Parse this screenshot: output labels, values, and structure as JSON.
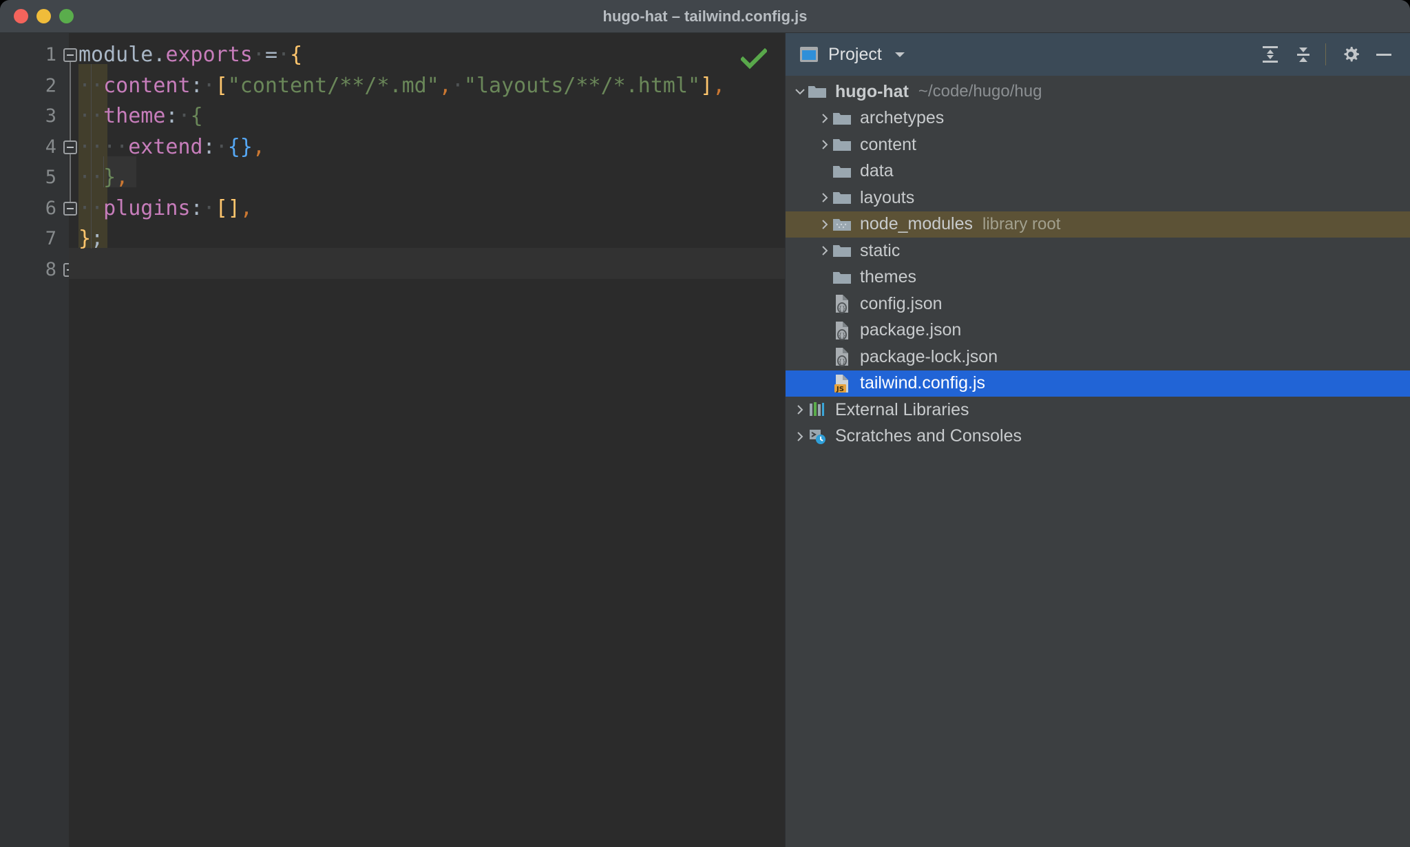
{
  "window": {
    "title": "hugo-hat – tailwind.config.js",
    "traffic_lights": [
      {
        "name": "close",
        "color": "#f4645c"
      },
      {
        "name": "minimize",
        "color": "#f0bc3a"
      },
      {
        "name": "maximize",
        "color": "#5aad4c"
      }
    ]
  },
  "editor": {
    "filename": "tailwind.config.js",
    "language": "JavaScript",
    "inspection_status": "ok-check",
    "line_numbers": [
      "1",
      "2",
      "3",
      "4",
      "5",
      "6",
      "7",
      "8"
    ],
    "lines": [
      {
        "number": "1",
        "tokens": [
          {
            "t": "module",
            "c": "plain"
          },
          {
            "t": ".",
            "c": "plain"
          },
          {
            "t": "exports",
            "c": "prop"
          },
          {
            "t": " ",
            "c": "ws"
          },
          {
            "t": "=",
            "c": "op"
          },
          {
            "t": " ",
            "c": "ws"
          },
          {
            "t": "{",
            "c": "brace"
          }
        ]
      },
      {
        "number": "2",
        "tokens": [
          {
            "t": "  ",
            "c": "ws"
          },
          {
            "t": "content",
            "c": "prop"
          },
          {
            "t": ":",
            "c": "plain"
          },
          {
            "t": " ",
            "c": "ws"
          },
          {
            "t": "[",
            "c": "brace"
          },
          {
            "t": "\"content/**/*.md\"",
            "c": "str"
          },
          {
            "t": ",",
            "c": "key"
          },
          {
            "t": " ",
            "c": "ws"
          },
          {
            "t": "\"layouts/**/*.html\"",
            "c": "str"
          },
          {
            "t": "]",
            "c": "brace"
          },
          {
            "t": ",",
            "c": "key"
          }
        ]
      },
      {
        "number": "3",
        "tokens": [
          {
            "t": "  ",
            "c": "ws"
          },
          {
            "t": "theme",
            "c": "prop"
          },
          {
            "t": ":",
            "c": "plain"
          },
          {
            "t": " ",
            "c": "ws"
          },
          {
            "t": "{",
            "c": "brace2"
          }
        ]
      },
      {
        "number": "4",
        "tokens": [
          {
            "t": "    ",
            "c": "ws"
          },
          {
            "t": "extend",
            "c": "prop"
          },
          {
            "t": ":",
            "c": "plain"
          },
          {
            "t": " ",
            "c": "ws"
          },
          {
            "t": "{}",
            "c": "brace3"
          },
          {
            "t": ",",
            "c": "key"
          }
        ]
      },
      {
        "number": "5",
        "tokens": [
          {
            "t": "  ",
            "c": "ws"
          },
          {
            "t": "}",
            "c": "brace2"
          },
          {
            "t": ",",
            "c": "key"
          }
        ]
      },
      {
        "number": "6",
        "tokens": [
          {
            "t": "  ",
            "c": "ws"
          },
          {
            "t": "plugins",
            "c": "prop"
          },
          {
            "t": ":",
            "c": "plain"
          },
          {
            "t": " ",
            "c": "ws"
          },
          {
            "t": "[]",
            "c": "brace"
          },
          {
            "t": ",",
            "c": "key"
          }
        ]
      },
      {
        "number": "7",
        "tokens": [
          {
            "t": "}",
            "c": "brace"
          },
          {
            "t": ";",
            "c": "plain"
          }
        ]
      },
      {
        "number": "8",
        "tokens": []
      }
    ]
  },
  "project_panel": {
    "header": {
      "title": "Project",
      "icons": [
        "project-window-icon",
        "chevron-down-icon",
        "expand-all-icon",
        "collapse-all-icon",
        "gear-icon",
        "hide-icon"
      ]
    },
    "tree": [
      {
        "label": "hugo-hat",
        "sub": "~/code/hugo/hug",
        "icon": "folder-icon",
        "arrow": "down",
        "depth": 0,
        "bold": true,
        "state": "normal"
      },
      {
        "label": "archetypes",
        "sub": "",
        "icon": "folder-icon",
        "arrow": "right",
        "depth": 1,
        "bold": false,
        "state": "normal"
      },
      {
        "label": "content",
        "sub": "",
        "icon": "folder-icon",
        "arrow": "right",
        "depth": 1,
        "bold": false,
        "state": "normal"
      },
      {
        "label": "data",
        "sub": "",
        "icon": "folder-icon",
        "arrow": "none",
        "depth": 1,
        "bold": false,
        "state": "normal"
      },
      {
        "label": "layouts",
        "sub": "",
        "icon": "folder-icon",
        "arrow": "right",
        "depth": 1,
        "bold": false,
        "state": "normal"
      },
      {
        "label": "node_modules",
        "sub": "library root",
        "icon": "folder-lib-icon",
        "arrow": "right",
        "depth": 1,
        "bold": false,
        "state": "highlighted"
      },
      {
        "label": "static",
        "sub": "",
        "icon": "folder-icon",
        "arrow": "right",
        "depth": 1,
        "bold": false,
        "state": "normal"
      },
      {
        "label": "themes",
        "sub": "",
        "icon": "folder-icon",
        "arrow": "none",
        "depth": 1,
        "bold": false,
        "state": "normal"
      },
      {
        "label": "config.json",
        "sub": "",
        "icon": "json-file-icon",
        "arrow": "none",
        "depth": 1,
        "bold": false,
        "state": "normal"
      },
      {
        "label": "package.json",
        "sub": "",
        "icon": "json-file-icon",
        "arrow": "none",
        "depth": 1,
        "bold": false,
        "state": "normal"
      },
      {
        "label": "package-lock.json",
        "sub": "",
        "icon": "json-file-icon",
        "arrow": "none",
        "depth": 1,
        "bold": false,
        "state": "normal"
      },
      {
        "label": "tailwind.config.js",
        "sub": "",
        "icon": "js-file-icon",
        "arrow": "none",
        "depth": 1,
        "bold": false,
        "state": "selected"
      },
      {
        "label": "External Libraries",
        "sub": "",
        "icon": "libraries-icon",
        "arrow": "right",
        "depth": 0,
        "bold": false,
        "state": "normal"
      },
      {
        "label": "Scratches and Consoles",
        "sub": "",
        "icon": "scratches-icon",
        "arrow": "right",
        "depth": 0,
        "bold": false,
        "state": "normal"
      }
    ]
  },
  "colors": {
    "titlebar_bg": "#41464b",
    "editor_bg": "#2b2b2b",
    "gutter_bg": "#313335",
    "panel_bg": "#3c3f41",
    "panel_header_bg": "#3b4a57",
    "selection_blue": "#2164d6",
    "highlight_olive": "#5c5236",
    "string_green": "#6a8759",
    "property_purple": "#c77dbb",
    "brace_yellow": "#ffc66d",
    "comma_orange": "#cc7832",
    "check_green": "#59a84b"
  }
}
